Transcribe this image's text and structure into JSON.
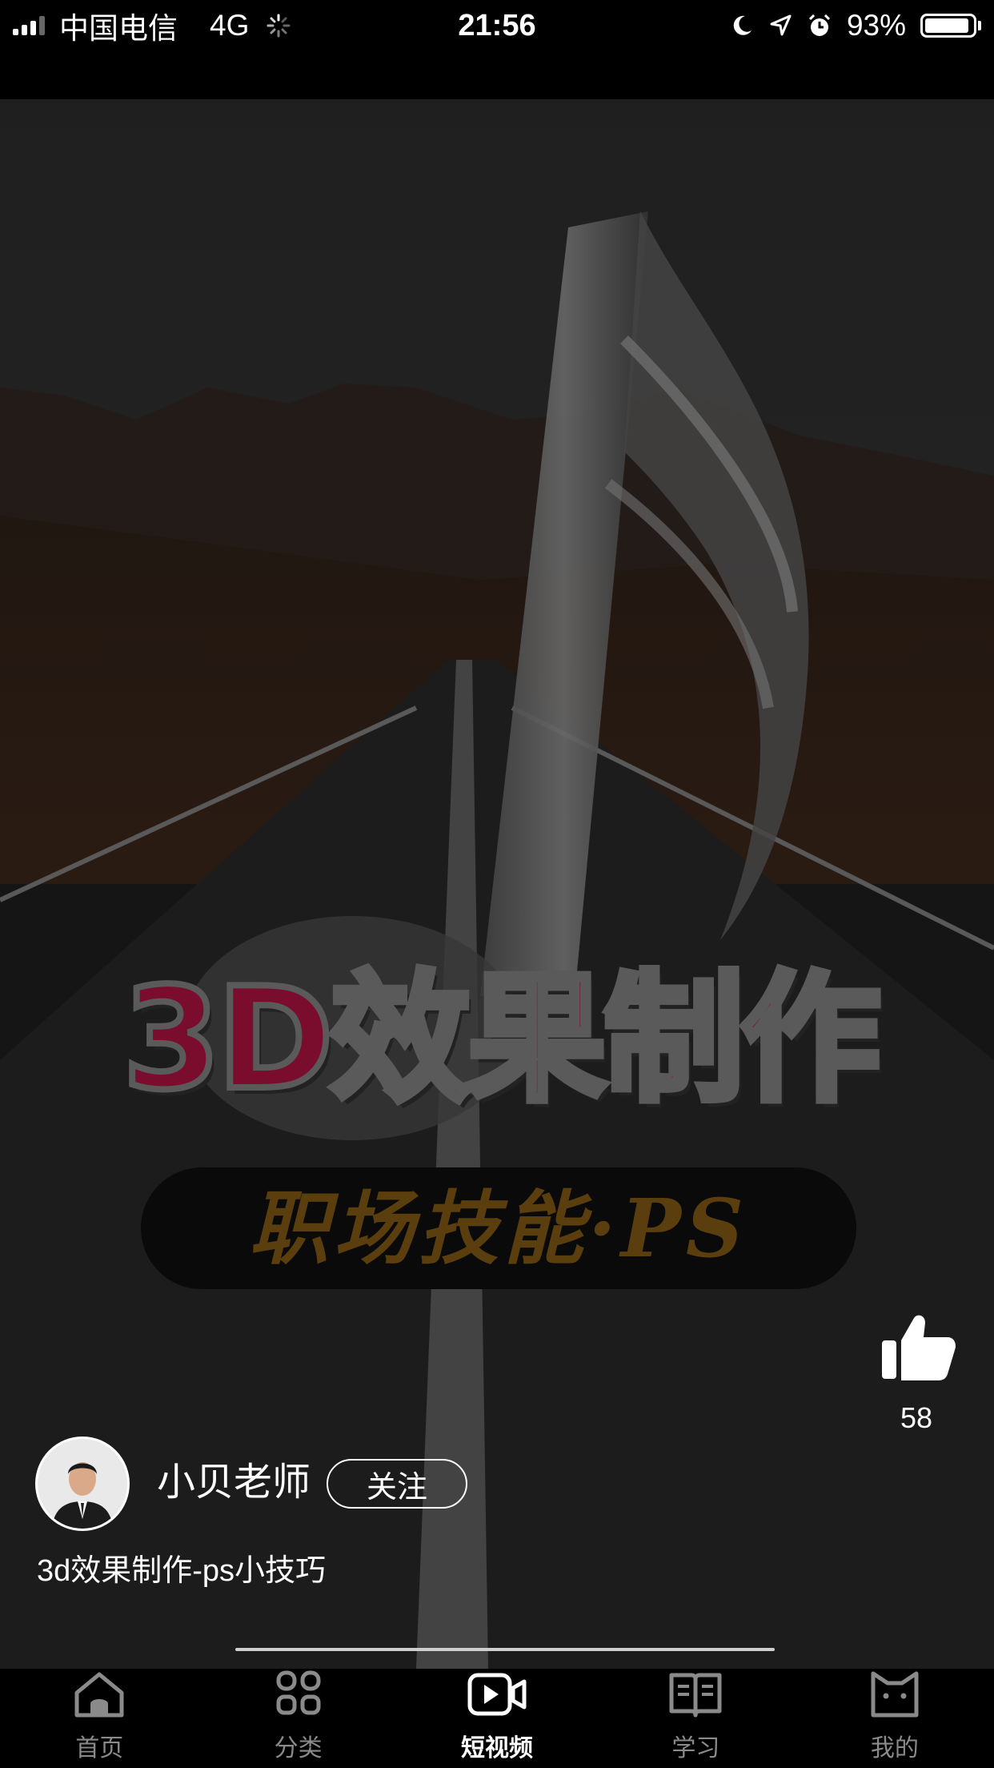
{
  "status_bar": {
    "carrier": "中国电信",
    "network": "4G",
    "time": "21:56",
    "battery": "93%",
    "battery_level": 0.93,
    "icons": [
      "signal-icon",
      "loading-spinner-icon",
      "moon-icon",
      "location-arrow-icon",
      "alarm-icon",
      "battery-icon"
    ]
  },
  "video": {
    "poster_title": "3D效果制作",
    "poster_subtitle": "职场技能·PS",
    "description": "3d效果制作-ps小技巧"
  },
  "author": {
    "name": "小贝老师",
    "follow_label": "关注"
  },
  "actions": {
    "like_icon": "thumbs-up-icon",
    "like_count": "58"
  },
  "tabbar": {
    "items": [
      {
        "label": "首页",
        "icon": "home-icon"
      },
      {
        "label": "分类",
        "icon": "category-grid-icon"
      },
      {
        "label": "短视频",
        "icon": "video-camera-icon",
        "active": true
      },
      {
        "label": "学习",
        "icon": "book-icon"
      },
      {
        "label": "我的",
        "icon": "profile-cat-icon"
      }
    ]
  },
  "colors": {
    "background": "#000000",
    "title_red": "#7a0d2e",
    "subtitle_gold": "#5b3e0e",
    "tab_inactive": "#8a8a8a",
    "tab_active": "#ffffff"
  }
}
